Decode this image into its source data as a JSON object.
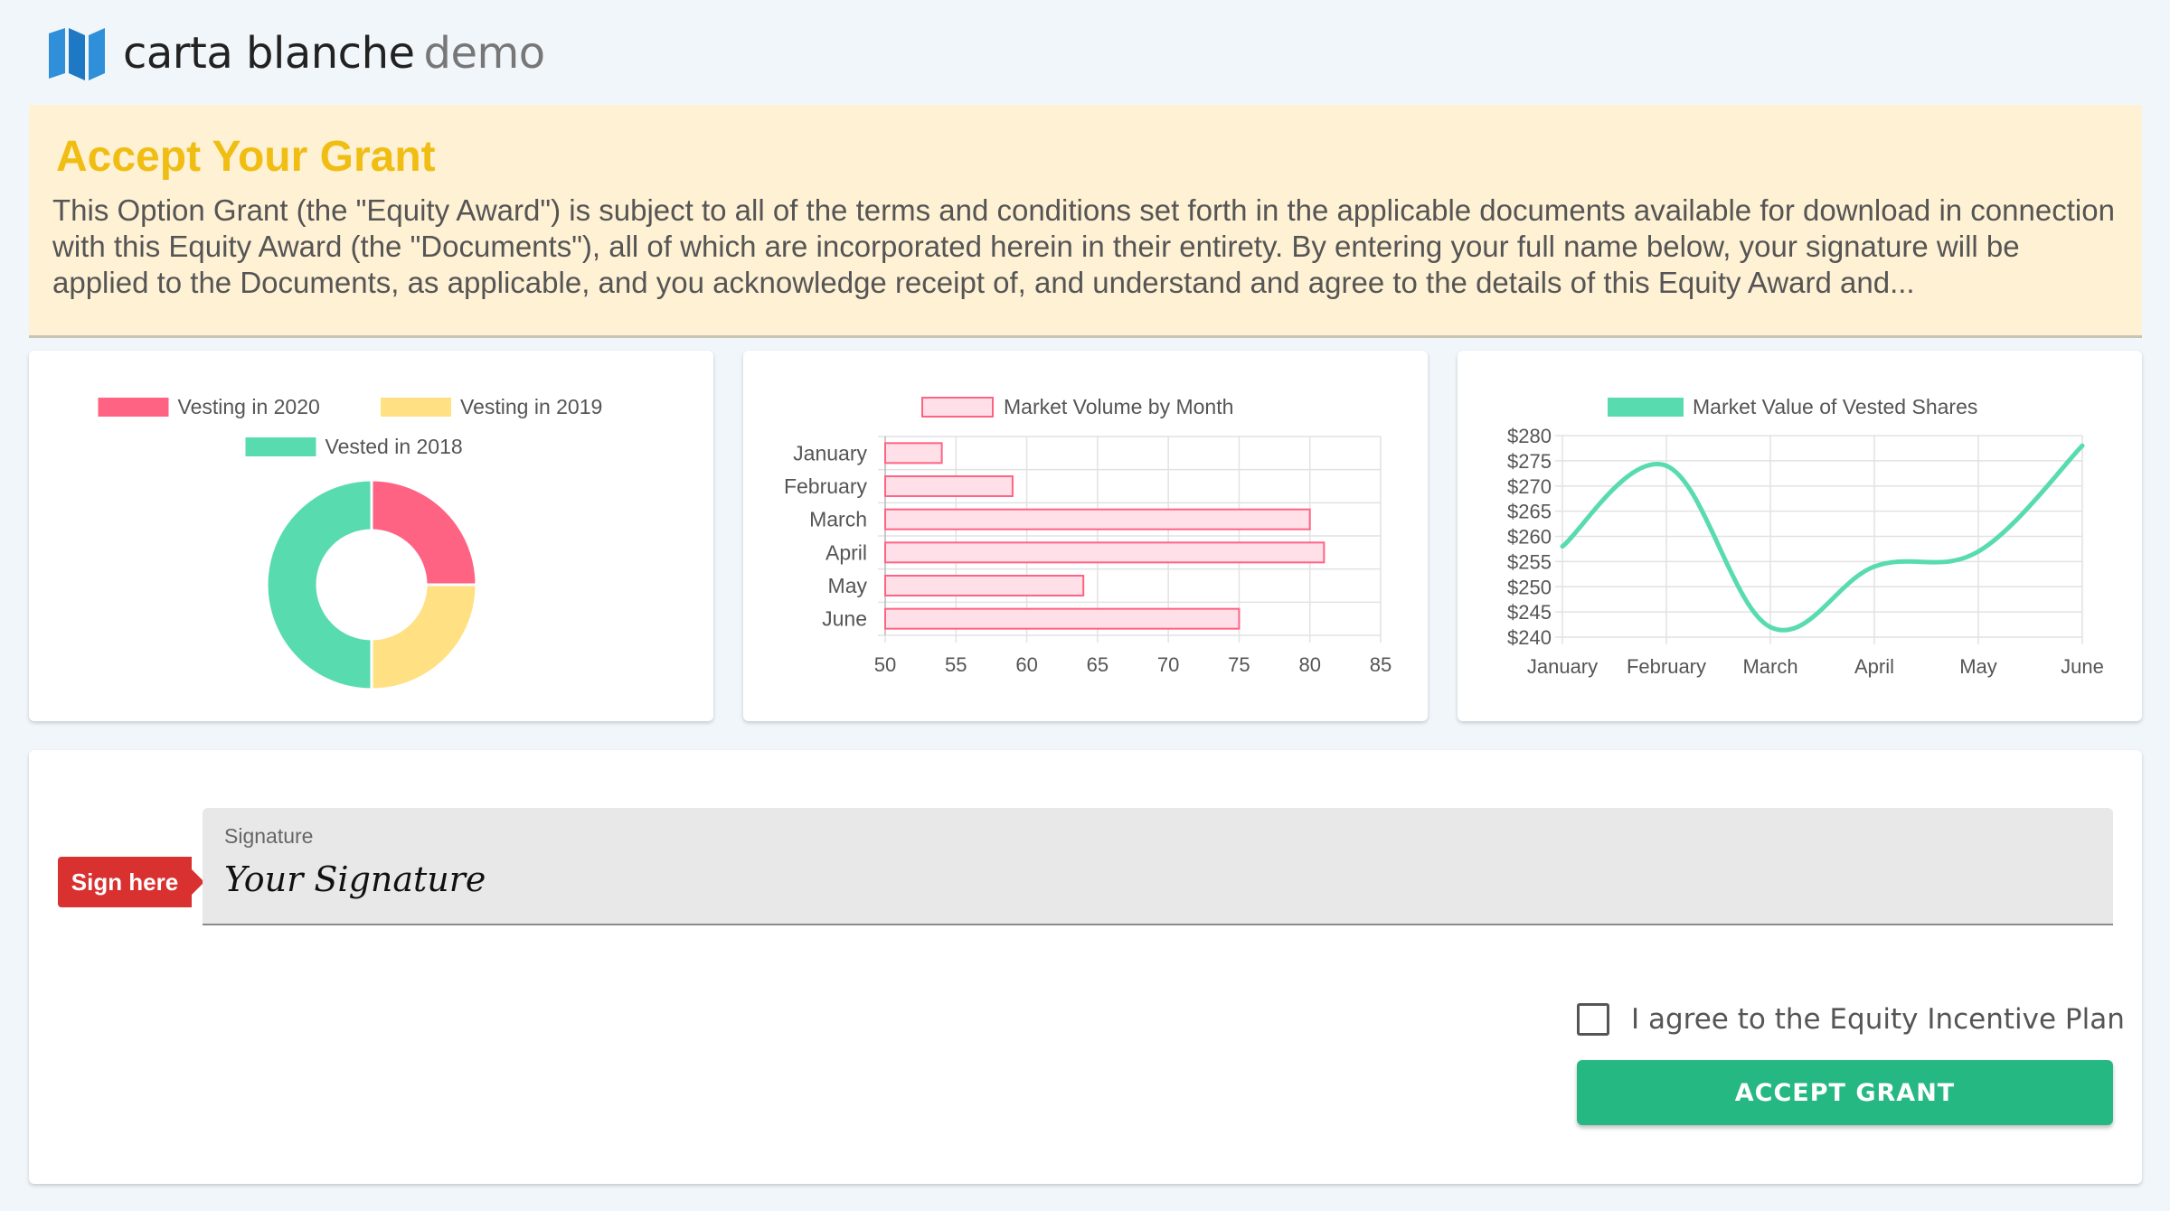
{
  "header": {
    "brand": "carta blanche",
    "suffix": "demo"
  },
  "banner": {
    "title": "Accept Your Grant",
    "body": "This Option Grant (the \"Equity Award\") is subject to all of the terms and conditions set forth in the applicable documents available for download in connection with this Equity Award (the \"Documents\"), all of which are incorporated herein in their entirety. By entering your full name below, your signature will be applied to the Documents, as applicable, and you acknowledge receipt of, and understand and agree to the details of this Equity Award and..."
  },
  "chart_data": [
    {
      "type": "doughnut",
      "legend": [
        "Vesting in 2020",
        "Vesting in 2019",
        "Vested in 2018"
      ],
      "values": [
        25,
        25,
        50
      ],
      "colors": [
        "#ff6384",
        "#ffe083",
        "#59dbb0"
      ]
    },
    {
      "type": "bar",
      "orientation": "horizontal",
      "series_name": "Market Volume by Month",
      "categories": [
        "January",
        "February",
        "March",
        "April",
        "May",
        "June"
      ],
      "values": [
        54,
        59,
        80,
        81,
        64,
        75
      ],
      "xlim": [
        50,
        85
      ],
      "xticks": [
        50,
        55,
        60,
        65,
        70,
        75,
        80,
        85
      ],
      "fill": "#ffe0e8",
      "stroke": "#ff6384"
    },
    {
      "type": "line",
      "series_name": "Market Value of Vested Shares",
      "categories": [
        "January",
        "February",
        "March",
        "April",
        "May",
        "June"
      ],
      "values": [
        258,
        274,
        242,
        254,
        257,
        278
      ],
      "ylim": [
        240,
        280
      ],
      "yticks": [
        "$240",
        "$245",
        "$250",
        "$255",
        "$260",
        "$265",
        "$270",
        "$275",
        "$280"
      ],
      "color": "#59dbb0"
    }
  ],
  "sign": {
    "tag": "Sign here",
    "field_label": "Signature",
    "placeholder": "Your Signature",
    "agree_label": "I agree to the Equity Incentive Plan",
    "accept_label": "ACCEPT GRANT"
  }
}
